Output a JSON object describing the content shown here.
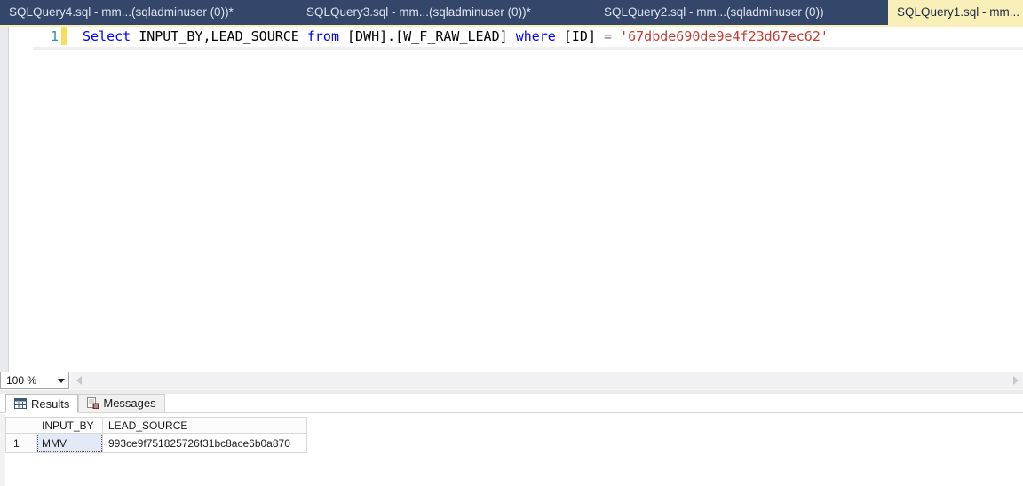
{
  "tab_bar": {
    "tabs": [
      {
        "label": "SQLQuery4.sql - mm...(sqladminuser (0))*",
        "state": "inactive"
      },
      {
        "label": "SQLQuery3.sql - mm...(sqladminuser (0))*",
        "state": "inactive"
      },
      {
        "label": "SQLQuery2.sql - mm...(sqladminuser (0))",
        "state": "inactive"
      },
      {
        "label": "SQLQuery1.sql - mm...",
        "state": "active"
      }
    ]
  },
  "editor": {
    "line_number": "1",
    "tokens": [
      {
        "text": "Select",
        "type": "keyword"
      },
      {
        "text": " INPUT_BY,LEAD_SOURCE ",
        "type": "plain"
      },
      {
        "text": "from",
        "type": "keyword"
      },
      {
        "text": " [DWH].[W_F_RAW_LEAD] ",
        "type": "plain"
      },
      {
        "text": "where",
        "type": "keyword"
      },
      {
        "text": " [ID] ",
        "type": "plain"
      },
      {
        "text": "= ",
        "type": "operator"
      },
      {
        "text": "'67dbde690de9e4f23d67ec62'",
        "type": "string"
      }
    ],
    "zoom_select": {
      "value": "100 %"
    }
  },
  "results_panel": {
    "tabs": [
      {
        "label": "Results",
        "icon": "results-grid-icon",
        "state": "active"
      },
      {
        "label": "Messages",
        "icon": "messages-icon",
        "state": "inactive"
      }
    ],
    "grid": {
      "columns": [
        "INPUT_BY",
        "LEAD_SOURCE"
      ],
      "rows": [
        {
          "row_header": "1",
          "cells": [
            "MMV",
            "993ce9f751825726f31bc8ace6b0a870"
          ],
          "selected_cell": "INPUT_BY"
        }
      ]
    }
  },
  "colors": {
    "tab_bar_bg": "#35466B",
    "active_tab_bg": "#F8EFB9",
    "keyword": "#0000FF",
    "string": "#C9372C",
    "operator": "#777777",
    "line_number": "#2B91AF",
    "change_bar_yellow": "#F2DF5E",
    "selected_cell_bg": "#E3E9F6"
  }
}
